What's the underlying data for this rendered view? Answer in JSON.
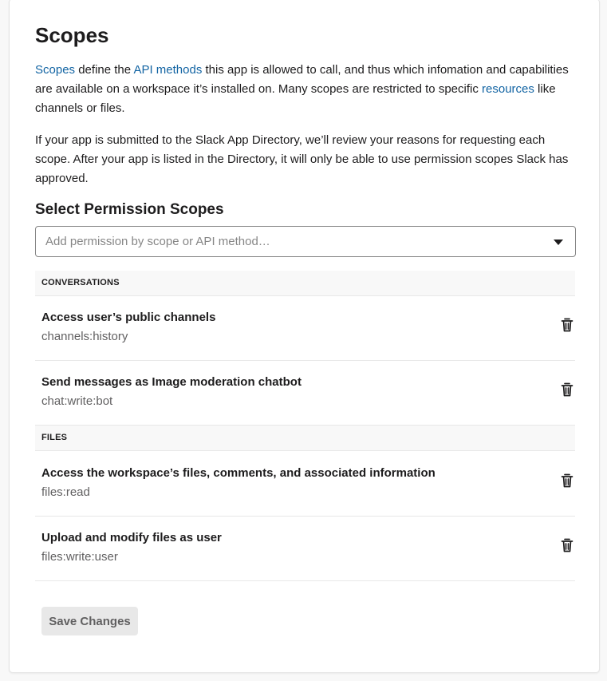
{
  "scopes": {
    "title": "Scopes",
    "intro": {
      "link1": "Scopes",
      "t1": " define the ",
      "link2": "API methods",
      "t2": " this app is allowed to call, and thus which infomation and capabilities are available on a workspace it’s installed on. Many scopes are restricted to specific ",
      "link3": "resources",
      "t3": " like channels or files."
    },
    "review_text": "If your app is submitted to the Slack App Directory, we’ll review your reasons for requesting each scope. After your app is listed in the Directory, it will only be able to use permission scopes Slack has approved."
  },
  "permissions": {
    "heading": "Select Permission Scopes",
    "select_placeholder": "Add permission by scope or API method…",
    "sections": [
      {
        "name": "CONVERSATIONS",
        "items": [
          {
            "title": "Access user’s public channels",
            "scope": "channels:history"
          },
          {
            "title": "Send messages as Image moderation chatbot",
            "scope": "chat:write:bot"
          }
        ]
      },
      {
        "name": "FILES",
        "items": [
          {
            "title": "Access the workspace’s files, comments, and associated information",
            "scope": "files:read"
          },
          {
            "title": "Upload and modify files as user",
            "scope": "files:write:user"
          }
        ]
      }
    ]
  },
  "actions": {
    "save_label": "Save Changes"
  },
  "icons": {
    "delete": "trash-icon",
    "dropdown": "caret-down-icon"
  },
  "colors": {
    "link": "#1264a3",
    "text": "#1d1c1d",
    "muted": "#616061",
    "section_bg": "#f8f8f8",
    "button_bg": "#e8e8e8"
  }
}
